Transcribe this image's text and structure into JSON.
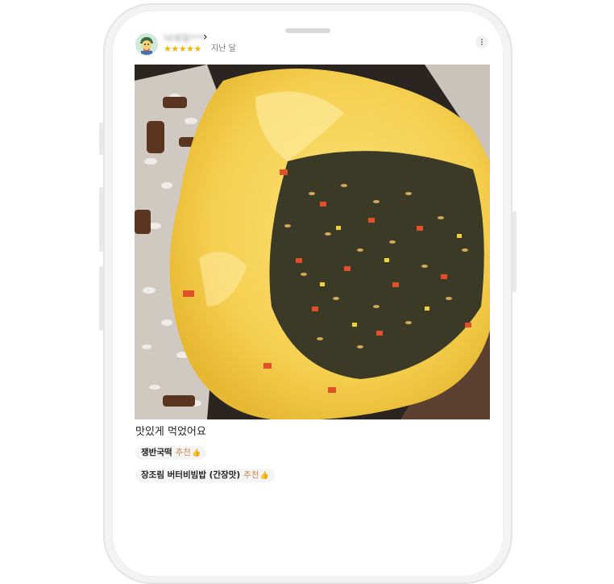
{
  "review": {
    "author_name": "닉네임***",
    "stars": "★★★★★",
    "rating": 5,
    "date": "지난 달",
    "text": "맛있게 먹었어요",
    "tags": [
      {
        "name": "쟁반국떡",
        "rec_label": "추천"
      },
      {
        "name": "장조림 버터비빔밥 (간장맛)",
        "rec_label": "추천"
      }
    ]
  },
  "icons": {
    "profile": "chevron-right-icon",
    "menu": "more-vertical-icon",
    "recommend": "thumbs-up-icon"
  },
  "colors": {
    "star": "#f5b800",
    "recommend": "#c58a4a"
  }
}
